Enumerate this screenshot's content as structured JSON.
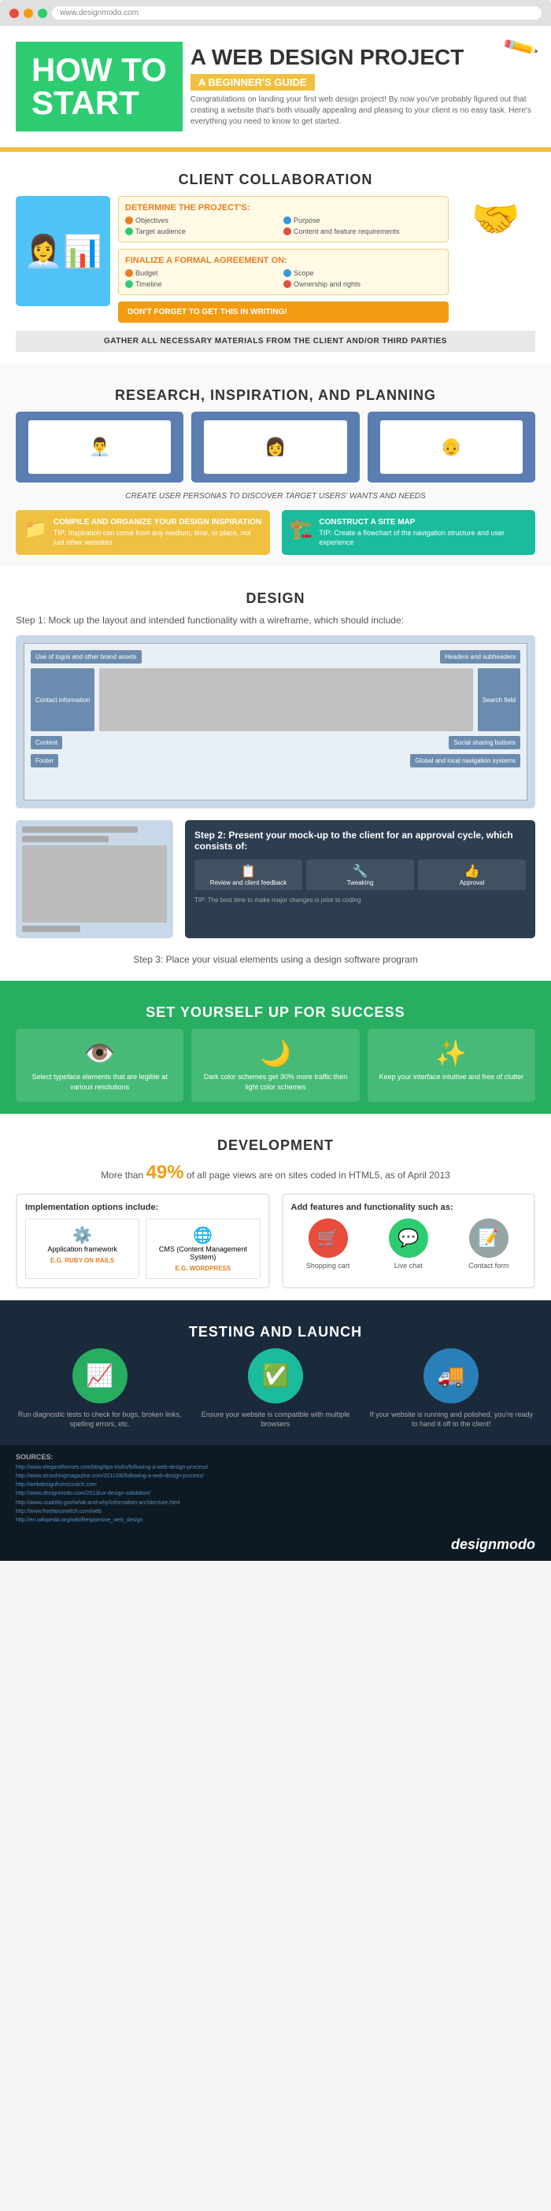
{
  "header": {
    "how_to": "HOW TO",
    "start": "START",
    "title": "A WEB DESIGN PROJECT",
    "subtitle": "A BEGINNER'S GUIDE",
    "description": "Congratulations on landing your first web design project! By now you've probably figured out that creating a website that's both visually appealing and pleasing to your client is no easy task. Here's everything you need to know to get started."
  },
  "browser": {
    "url": "www.designmodo.com"
  },
  "client_collab": {
    "section_title": "CLIENT COLLABORATION",
    "box1_title": "DETERMINE THE PROJECT'S:",
    "box1_items": [
      "Objectives",
      "Purpose",
      "Target audience",
      "Content and feature requirements"
    ],
    "box2_title": "FINALIZE A FORMAL AGREEMENT ON:",
    "box2_items": [
      "Budget",
      "Scope",
      "Timeline",
      "Ownership and rights"
    ],
    "dont_forget": "DON'T FORGET to get this in writing!",
    "gather_text": "GATHER ALL NECESSARY MATERIALS FROM THE CLIENT AND/OR THIRD PARTIES"
  },
  "research": {
    "section_title": "RESEARCH, INSPIRATION, AND PLANNING",
    "persona_label": "CREATE USER PERSONAS TO DISCOVER TARGET USERS' WANTS AND NEEDS",
    "card1_title": "COMPILE AND ORGANIZE YOUR DESIGN INSPIRATION",
    "card1_tip": "TIP: Inspiration can come from any medium, time, or place, not just other websites",
    "card2_title": "CONSTRUCT A SITE MAP",
    "card2_tip": "TIP: Create a flowchart of the navigation structure and user experience"
  },
  "design": {
    "section_title": "DESIGN",
    "step1_text": "Step 1: Mock up the layout and intended functionality with a wireframe, which should include:",
    "wireframe_labels_left": [
      "Use of logos and other brand assets",
      "Contact information",
      "Content",
      "Footer"
    ],
    "wireframe_labels_right": [
      "Headers and subheaders",
      "Search field",
      "Social sharing buttons",
      "Global and local navigation systems"
    ],
    "step2_title": "Step 2: Present your mock-up to the client for an approval cycle, which consists of:",
    "step2_steps": [
      "Review and client feedback",
      "Tweaking",
      "Approval"
    ],
    "step2_tip": "TIP: The best time to make major changes is prior to coding",
    "step3_text": "Step 3: Place your visual elements using a design software program"
  },
  "success": {
    "section_title": "SET YOURSELF UP FOR SUCCESS",
    "card1_text": "Select typeface elements that are legible at various resolutions",
    "card2_text": "Dark color schemes get 30% more traffic then light color schemes",
    "card3_text": "Keep your interface intuitive and free of clutter"
  },
  "development": {
    "section_title": "DEVELOPMENT",
    "stat_text": "More than",
    "stat_number": "49%",
    "stat_suffix": "of all page views are on sites coded in HTML5, as of April 2013",
    "impl_title": "Implementation options include:",
    "impl_item1": "Application framework",
    "impl_item1_eg": "e.g. RUBY ON RAILS",
    "impl_item2": "CMS (Content Management System)",
    "impl_item2_eg": "e.g. WORDPRESS",
    "features_title": "Add features and functionality such as:",
    "feature1": "Shopping cart",
    "feature2": "Live chat",
    "feature3": "Contact form"
  },
  "testing": {
    "section_title": "TESTING AND LAUNCH",
    "card1_text": "Run diagnostic tests to check for bugs, broken links, spelling errors, etc.",
    "card2_text": "Ensure your website is compatible with multiple browsers",
    "card3_text": "If your website is running and polished, you're ready to hand it off to the client!"
  },
  "sources": {
    "title": "SOURCES:",
    "links": [
      "http://www.elegantthemes.com/blog/tips-tricks/following-a-web-design-process/",
      "http://www.smashingmagazine.com/2011/06/following-a-web-design-process/",
      "http://webdesignfromscratch.com",
      "http://www.designmodo.com/2013/ux-design-validation/",
      "http://www.usability.gov/what-and-why/information-architecture.html",
      "http://www.freelancewitch.com/web",
      "http://en.wikipedia.org/wiki/Responsive_web_design"
    ]
  },
  "brand": "designmodo"
}
